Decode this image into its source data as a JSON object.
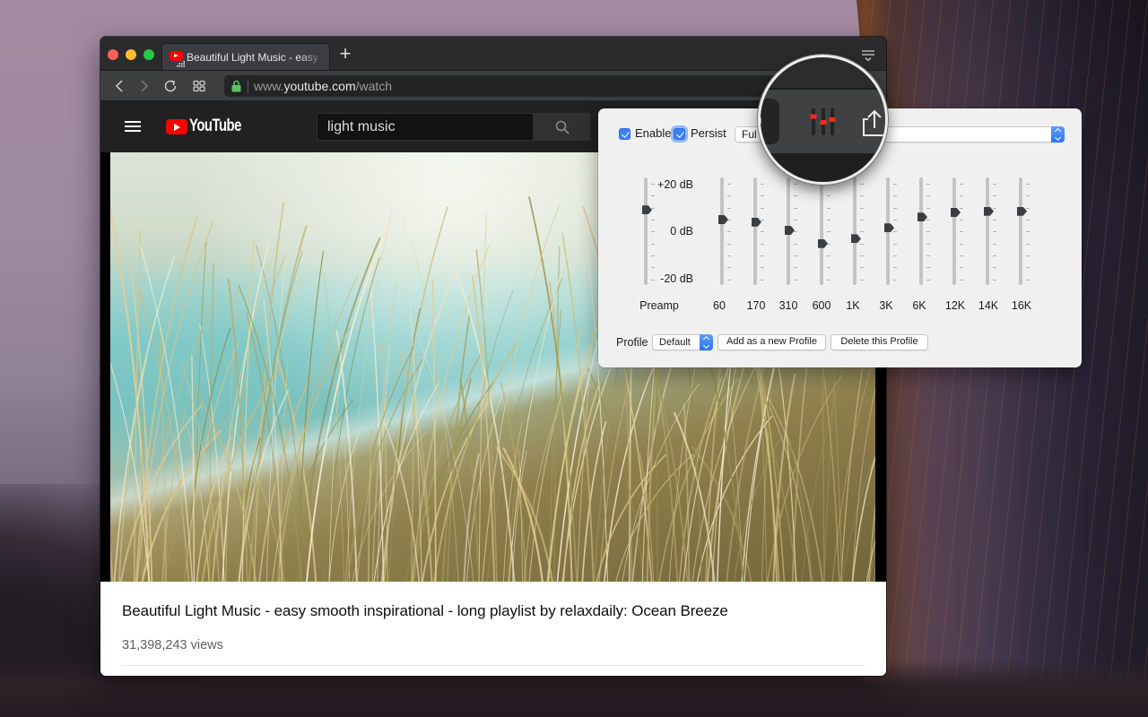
{
  "browser": {
    "tab": {
      "title": "Beautiful Light Music - easy s",
      "favicon": "youtube-favicon-icon",
      "audio_indicator": "audio-playing-icon"
    },
    "new_tab_label": "+",
    "url": {
      "prefix": "www.",
      "domain": "youtube.com",
      "path": "/watch"
    },
    "toolbar_icons": [
      "back-icon",
      "forward-icon",
      "reload-icon",
      "tab-grid-icon",
      "lock-icon",
      "tab-list-icon"
    ]
  },
  "youtube": {
    "logo_text": "YouTube",
    "search": {
      "value": "light music"
    }
  },
  "video": {
    "title": "Beautiful Light Music - easy smooth inspirational - long playlist by relaxdaily: Ocean Breeze",
    "views": "31,398,243 views"
  },
  "equalizer": {
    "enable": {
      "label": "Enable",
      "checked": true
    },
    "persist": {
      "label": "Persist",
      "checked": true
    },
    "mode_select": {
      "value": "Ful"
    },
    "db_labels": {
      "max": "+20 dB",
      "mid": "0 dB",
      "min": "-20 dB"
    },
    "range_db": [
      -20,
      20
    ],
    "preamp": {
      "label": "Preamp",
      "gain_db": 9
    },
    "bands": [
      {
        "label": "60",
        "gain_db": 5
      },
      {
        "label": "170",
        "gain_db": 4
      },
      {
        "label": "310",
        "gain_db": 0.5
      },
      {
        "label": "600",
        "gain_db": -5
      },
      {
        "label": "1K",
        "gain_db": -3
      },
      {
        "label": "3K",
        "gain_db": 1.5
      },
      {
        "label": "6K",
        "gain_db": 6
      },
      {
        "label": "12K",
        "gain_db": 8
      },
      {
        "label": "14K",
        "gain_db": 8.5
      },
      {
        "label": "16K",
        "gain_db": 8.5
      }
    ],
    "profile": {
      "label": "Profile",
      "selected": "Default",
      "add_button": "Add as a new Profile",
      "delete_button": "Delete this Profile"
    }
  },
  "magnifier": {
    "icons": [
      "equalizer-extension-icon",
      "share-icon"
    ]
  },
  "colors": {
    "accent": "#3a82f7",
    "youtube_red": "#ff0000",
    "eq_knob_red": "#ff2a1a",
    "slider_handle": "#3b3e41",
    "lock_green": "#5fc15f"
  }
}
